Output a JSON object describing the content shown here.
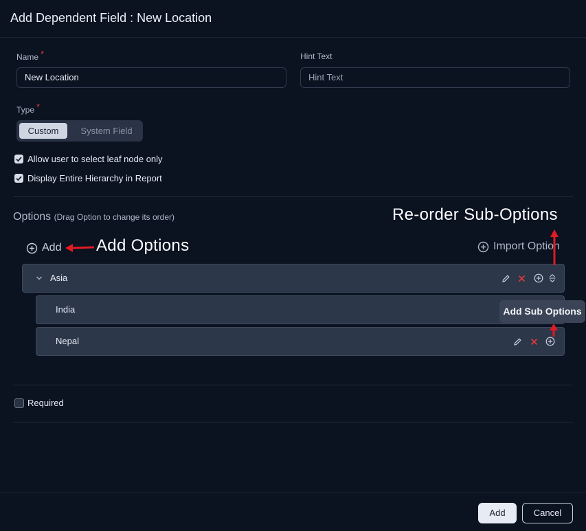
{
  "dialog": {
    "title": "Add Dependent Field : New Location"
  },
  "form": {
    "name": {
      "label": "Name",
      "required_mark": "*",
      "value": "New Location"
    },
    "hint": {
      "label": "Hint Text",
      "placeholder": "Hint Text"
    },
    "type": {
      "label": "Type",
      "required_mark": "*",
      "options": [
        "Custom",
        "System Field"
      ],
      "selected": "Custom"
    },
    "checkboxes": [
      {
        "label": "Allow user to select leaf node only",
        "checked": true
      },
      {
        "label": "Display Entire Hierarchy in Report",
        "checked": true
      }
    ],
    "required": {
      "label": "Required",
      "checked": false
    }
  },
  "options": {
    "title": "Options",
    "subtitle": "(Drag Option to change its order)",
    "add_label": "Add",
    "import_label": "Import Option",
    "tree": [
      {
        "label": "Asia",
        "expanded": true,
        "children": [
          {
            "label": "India"
          },
          {
            "label": "Nepal"
          }
        ]
      }
    ],
    "tooltip": "Add Sub Options"
  },
  "annotations": {
    "add_options": "Add Options",
    "reorder": "Re-order Sub-Options"
  },
  "footer": {
    "add_label": "Add",
    "cancel_label": "Cancel"
  },
  "colors": {
    "background": "#0b1220",
    "row": "#2c374a",
    "danger": "#e23a3a",
    "annotation_arrow": "#e01b24"
  },
  "icons": [
    "plus-circle-icon",
    "chevron-down-icon",
    "pencil-icon",
    "close-icon",
    "sort-icon",
    "check-icon"
  ]
}
